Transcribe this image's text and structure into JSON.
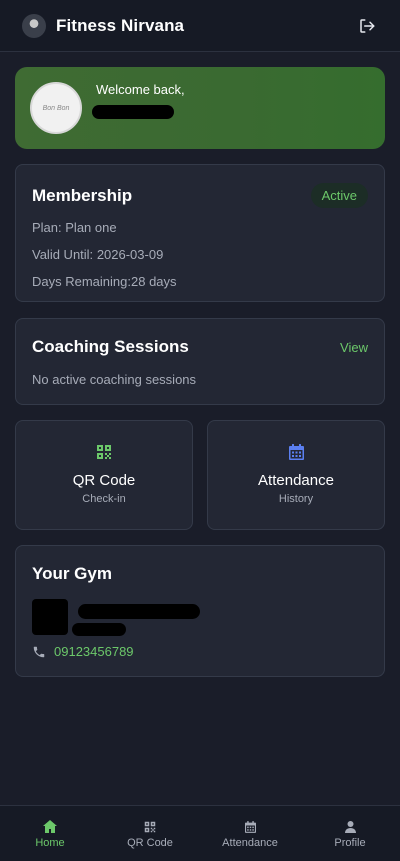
{
  "header": {
    "title": "Fitness Nirvana",
    "logo_icon": "gym-logo-icon",
    "logout_icon": "logout-icon"
  },
  "welcome": {
    "greeting": "Welcome back,",
    "avatar_text": "Bon Bon"
  },
  "membership": {
    "title": "Membership",
    "status": "Active",
    "plan_label": "Plan:",
    "plan_value": "Plan one",
    "valid_label": "Valid Until:",
    "valid_value": "2026-03-09",
    "remaining_label": "Days Remaining:",
    "remaining_value": "28 days"
  },
  "coaching": {
    "title": "Coaching Sessions",
    "view_label": "View",
    "empty_text": "No active coaching sessions"
  },
  "tiles": [
    {
      "title": "QR Code",
      "subtitle": "Check-in",
      "icon": "qr-code-icon"
    },
    {
      "title": "Attendance",
      "subtitle": "History",
      "icon": "calendar-icon"
    }
  ],
  "gym": {
    "title": "Your Gym",
    "phone": "09123456789",
    "phone_icon": "phone-icon"
  },
  "nav": [
    {
      "label": "Home",
      "icon": "home-icon",
      "active": true
    },
    {
      "label": "QR Code",
      "icon": "qr-code-icon",
      "active": false
    },
    {
      "label": "Attendance",
      "icon": "calendar-icon",
      "active": false
    },
    {
      "label": "Profile",
      "icon": "user-icon",
      "active": false
    }
  ],
  "colors": {
    "background": "#1a1d29",
    "card": "#232734",
    "accent_green": "#6cc86a",
    "welcome_green": "#3f6b33",
    "calendar_blue": "#5b7ff0"
  }
}
